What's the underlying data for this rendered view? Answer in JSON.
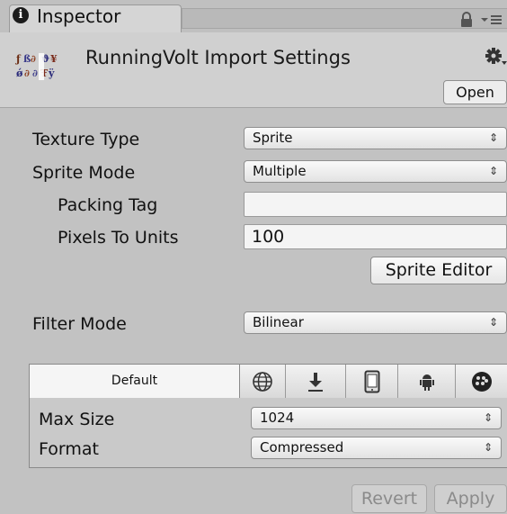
{
  "window": {
    "tab_label": "Inspector"
  },
  "header": {
    "title": "RunningVolt Import Settings",
    "open_label": "Open"
  },
  "settings": {
    "texture_type": {
      "label": "Texture Type",
      "value": "Sprite"
    },
    "sprite_mode": {
      "label": "Sprite Mode",
      "value": "Multiple"
    },
    "packing_tag": {
      "label": "Packing Tag",
      "value": ""
    },
    "pixels_to_units": {
      "label": "Pixels To Units",
      "value": "100"
    },
    "sprite_editor_label": "Sprite Editor",
    "filter_mode": {
      "label": "Filter Mode",
      "value": "Bilinear"
    }
  },
  "platform": {
    "tabs": [
      {
        "label": "Default",
        "selected": true
      },
      {
        "icon": "globe-icon"
      },
      {
        "icon": "download-icon"
      },
      {
        "icon": "mobile-icon"
      },
      {
        "icon": "android-icon"
      },
      {
        "icon": "blackberry-icon"
      }
    ],
    "max_size": {
      "label": "Max Size",
      "value": "1024"
    },
    "format": {
      "label": "Format",
      "value": "Compressed"
    }
  },
  "footer": {
    "revert_label": "Revert",
    "apply_label": "Apply"
  },
  "colors": {
    "background": "#c2c2c2",
    "header": "#d0d0d0",
    "disabled_text": "#8a8a8a"
  }
}
